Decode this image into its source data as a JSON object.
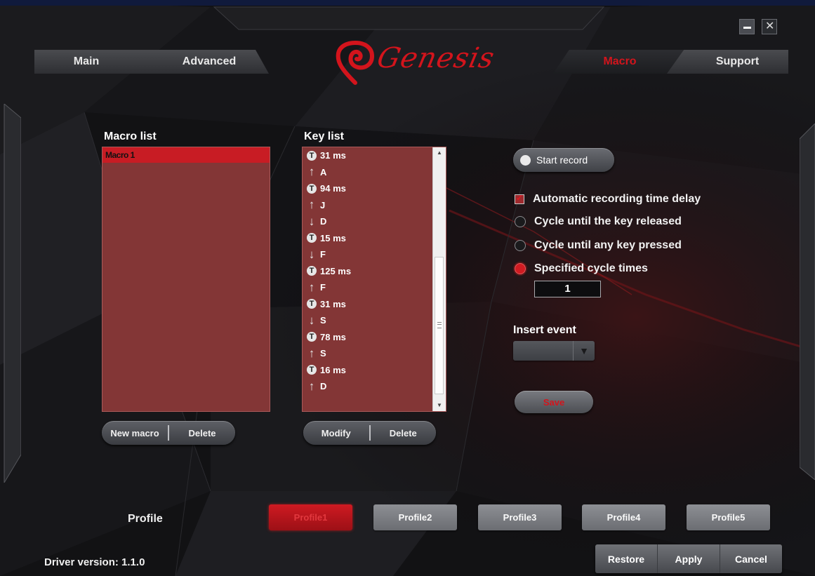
{
  "window": {
    "minimize_icon": "minimize-icon",
    "close_icon": "close-icon",
    "close_glyph": "✕"
  },
  "brand": {
    "logo_text": "Genesis",
    "accent": "#d3141c"
  },
  "tabs": [
    {
      "label": "Main",
      "active": false
    },
    {
      "label": "Advanced",
      "active": false
    },
    {
      "label": "Macro",
      "active": true
    },
    {
      "label": "Support",
      "active": false
    }
  ],
  "macro_list": {
    "title": "Macro list",
    "items": [
      "Macro 1"
    ],
    "selected": "Macro 1",
    "buttons": {
      "new": "New macro",
      "delete": "Delete"
    }
  },
  "key_list": {
    "title": "Key list",
    "rows": [
      {
        "icon": "T",
        "text": "31 ms"
      },
      {
        "icon": "↑",
        "text": "A"
      },
      {
        "icon": "T",
        "text": "94 ms"
      },
      {
        "icon": "↑",
        "text": "J"
      },
      {
        "icon": "↓",
        "text": "D"
      },
      {
        "icon": "T",
        "text": "15 ms"
      },
      {
        "icon": "↓",
        "text": "F"
      },
      {
        "icon": "T",
        "text": "125 ms"
      },
      {
        "icon": "↑",
        "text": "F"
      },
      {
        "icon": "T",
        "text": "31 ms"
      },
      {
        "icon": "↓",
        "text": "S"
      },
      {
        "icon": "T",
        "text": "78 ms"
      },
      {
        "icon": "↑",
        "text": "S"
      },
      {
        "icon": "T",
        "text": "16 ms"
      },
      {
        "icon": "↑",
        "text": "D"
      }
    ],
    "buttons": {
      "modify": "Modify",
      "delete": "Delete"
    }
  },
  "recording": {
    "start_label": "Start record",
    "auto_delay_label": "Automatic recording time delay",
    "auto_delay_checked": true,
    "cycle_options": [
      {
        "label": "Cycle until the key released",
        "selected": false
      },
      {
        "label": "Cycle until any key pressed",
        "selected": false
      },
      {
        "label": "Specified cycle times",
        "selected": true
      }
    ],
    "cycle_times": "1",
    "insert_event_label": "Insert event",
    "insert_event_value": "",
    "save_label": "Save"
  },
  "profiles": {
    "label": "Profile",
    "items": [
      "Profile1",
      "Profile2",
      "Profile3",
      "Profile4",
      "Profile5"
    ],
    "active": "Profile1"
  },
  "footer": {
    "driver_version": "Driver version:  1.1.0",
    "restore": "Restore",
    "apply": "Apply",
    "cancel": "Cancel"
  }
}
